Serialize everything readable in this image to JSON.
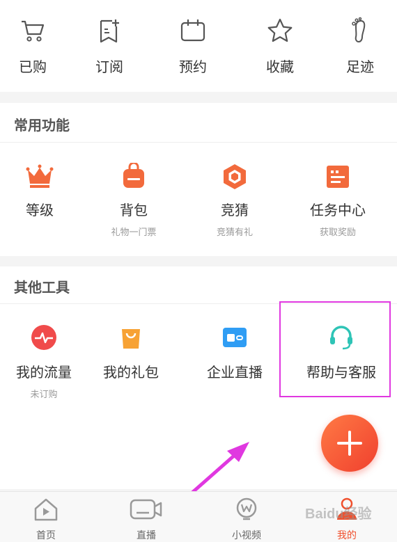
{
  "quick": [
    {
      "label": "已购",
      "icon": "cart-icon"
    },
    {
      "label": "订阅",
      "icon": "subscribe-icon"
    },
    {
      "label": "预约",
      "icon": "calendar-icon"
    },
    {
      "label": "收藏",
      "icon": "star-icon"
    },
    {
      "label": "足迹",
      "icon": "footprint-icon"
    }
  ],
  "common": {
    "title": "常用功能",
    "items": [
      {
        "label": "等级",
        "sub": "",
        "icon": "crown-icon"
      },
      {
        "label": "背包",
        "sub": "礼物一门票",
        "icon": "backpack-icon"
      },
      {
        "label": "竞猜",
        "sub": "竞猜有礼",
        "icon": "hexagon-icon"
      },
      {
        "label": "任务中心",
        "sub": "获取奖励",
        "icon": "task-icon"
      }
    ]
  },
  "tools": {
    "title": "其他工具",
    "items": [
      {
        "label": "我的流量",
        "sub": "未订购",
        "icon": "traffic-icon"
      },
      {
        "label": "我的礼包",
        "sub": "",
        "icon": "gift-bag-icon"
      },
      {
        "label": "企业直播",
        "sub": "",
        "icon": "enterprise-live-icon"
      },
      {
        "label": "帮助与客服",
        "sub": "",
        "icon": "headset-icon"
      }
    ]
  },
  "tabs": [
    {
      "label": "首页",
      "icon": "home-icon"
    },
    {
      "label": "直播",
      "icon": "live-icon"
    },
    {
      "label": "小视频",
      "icon": "short-video-icon"
    },
    {
      "label": "我的",
      "icon": "profile-icon"
    }
  ],
  "active_tab": "我的",
  "watermark": "Baidu经验",
  "colors": {
    "accent": "#f0502d",
    "highlight": "#e038e0",
    "teal": "#2ec4b6"
  }
}
